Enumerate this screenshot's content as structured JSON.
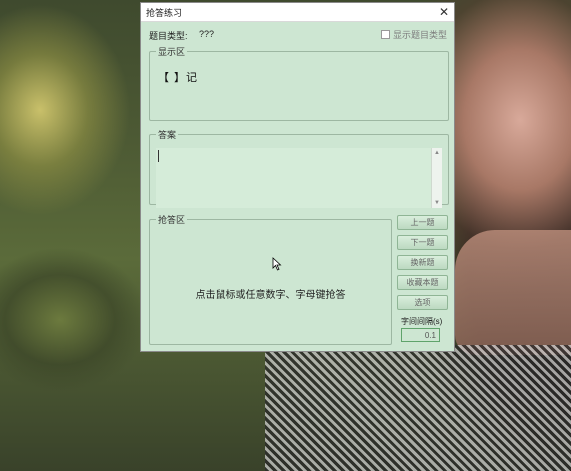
{
  "window": {
    "title": "抢答练习",
    "close_glyph": "✕"
  },
  "question_type": {
    "label": "题目类型:",
    "value": "???",
    "show_checkbox_label": "显示题目类型",
    "show_checkbox_checked": false
  },
  "display_area": {
    "legend": "显示区",
    "question_text": "【   】记"
  },
  "answer_area": {
    "legend": "答案",
    "value": ""
  },
  "buzz_area": {
    "legend": "抢答区",
    "hint": "点击鼠标或任意数字、字母键抢答"
  },
  "buttons": {
    "prev": "上一题",
    "next": "下一题",
    "new": "换新题",
    "favorite": "收藏本题",
    "options": "选项"
  },
  "interval": {
    "label": "字间间隔(s)",
    "value": "0.1"
  },
  "icons": {
    "cursor": "mouse-pointer-icon",
    "checkbox": "checkbox-icon",
    "close": "close-icon"
  }
}
